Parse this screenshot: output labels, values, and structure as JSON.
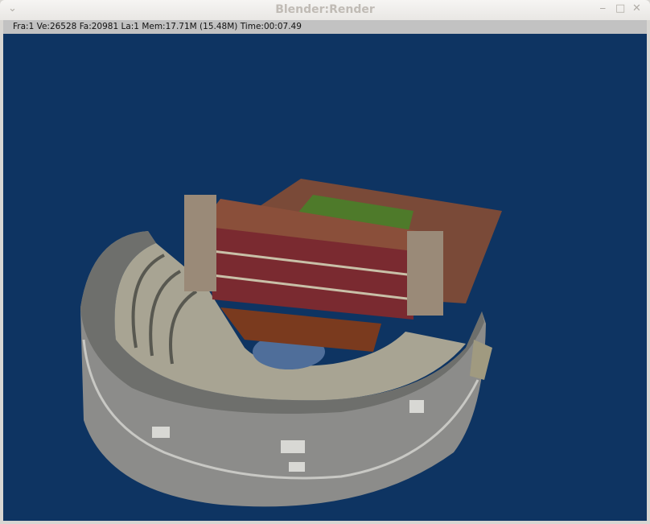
{
  "window": {
    "title": "Blender:Render",
    "menu_icon": "chevron-down-icon",
    "controls": [
      "minimize-icon",
      "maximize-icon",
      "close-icon"
    ]
  },
  "status": {
    "text": "Fra:1  Ve:26528 Fa:20981 La:1 Mem:17.71M (15.48M) Time:00:07.49"
  },
  "colors": {
    "background": "#0e3462",
    "stone": "#8a8a88",
    "roof": "#7a4a38",
    "grass": "#4e7a2a",
    "wall": "#7a2a30"
  }
}
